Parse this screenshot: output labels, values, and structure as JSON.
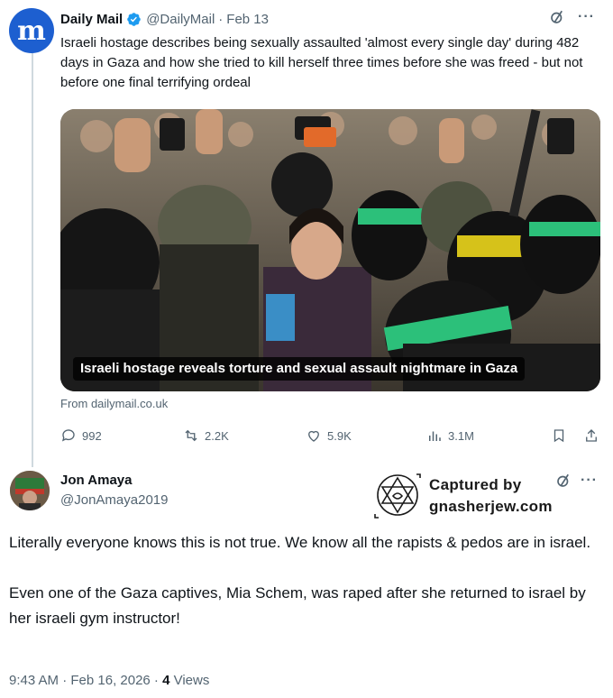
{
  "tweet1": {
    "display_name": "Daily Mail",
    "handle": "@DailyMail",
    "separator": "·",
    "date": "Feb 13",
    "avatar_letter": "m",
    "text": "Israeli hostage describes being sexually assaulted 'almost every single day' during 482 days in Gaza and how she tried to kill herself three times before she was freed - but not before one final terrifying ordeal",
    "media_caption": "Israeli hostage reveals torture and sexual assault nightmare in Gaza",
    "source": "From dailymail.co.uk",
    "stats": {
      "replies": "992",
      "reposts": "2.2K",
      "likes": "5.9K",
      "views": "3.1M"
    },
    "colors": {
      "brand_blue": "#1d5fd0",
      "verified": "#1d9bf0"
    }
  },
  "watermark": {
    "line1": "Captured by",
    "line2": "gnasherjew.com"
  },
  "tweet2": {
    "display_name": "Jon Amaya",
    "handle": "@JonAmaya2019",
    "paragraph1": "Literally everyone knows this is not true. We know all the rapists & pedos are in israel.",
    "paragraph2": "Even one of the Gaza captives, Mia Schem, was raped after she returned to israel by her israeli gym instructor!",
    "timestamp": "9:43 AM · Feb 16, 2026 · ",
    "views_count": "4",
    "views_label": " Views"
  },
  "icons": [
    "verified-badge-icon",
    "grok-icon",
    "more-icon",
    "reply-icon",
    "repost-icon",
    "like-icon",
    "views-icon",
    "bookmark-icon",
    "share-icon"
  ]
}
